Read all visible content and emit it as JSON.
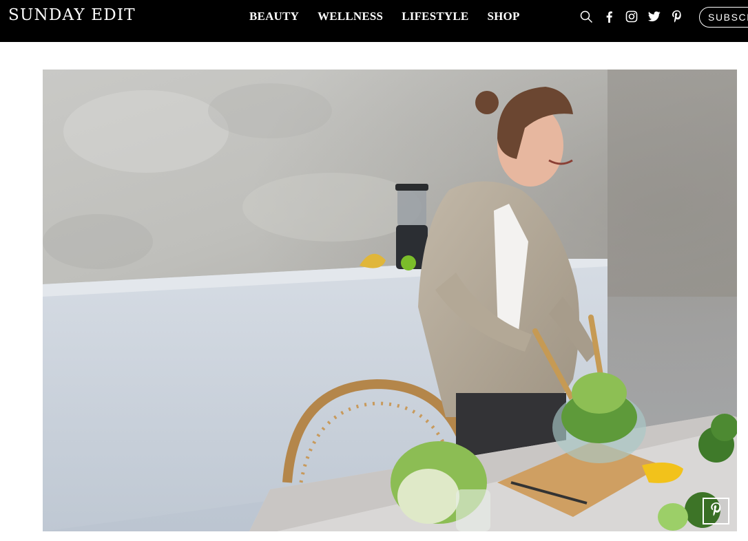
{
  "site": {
    "logo": "SUNDAY EDIT"
  },
  "nav": {
    "items": [
      {
        "label": "BEAUTY"
      },
      {
        "label": "WELLNESS"
      },
      {
        "label": "LIFESTYLE"
      },
      {
        "label": "SHOP"
      }
    ]
  },
  "header_icons": [
    "search-icon",
    "facebook-icon",
    "instagram-icon",
    "twitter-icon",
    "pinterest-icon"
  ],
  "subscribe": {
    "label": "SUBSCRIBE"
  },
  "hero": {
    "pin_icon": "pinterest-save-icon"
  },
  "colors": {
    "header_bg": "#000000",
    "header_text": "#ffffff",
    "page_bg": "#ffffff"
  }
}
